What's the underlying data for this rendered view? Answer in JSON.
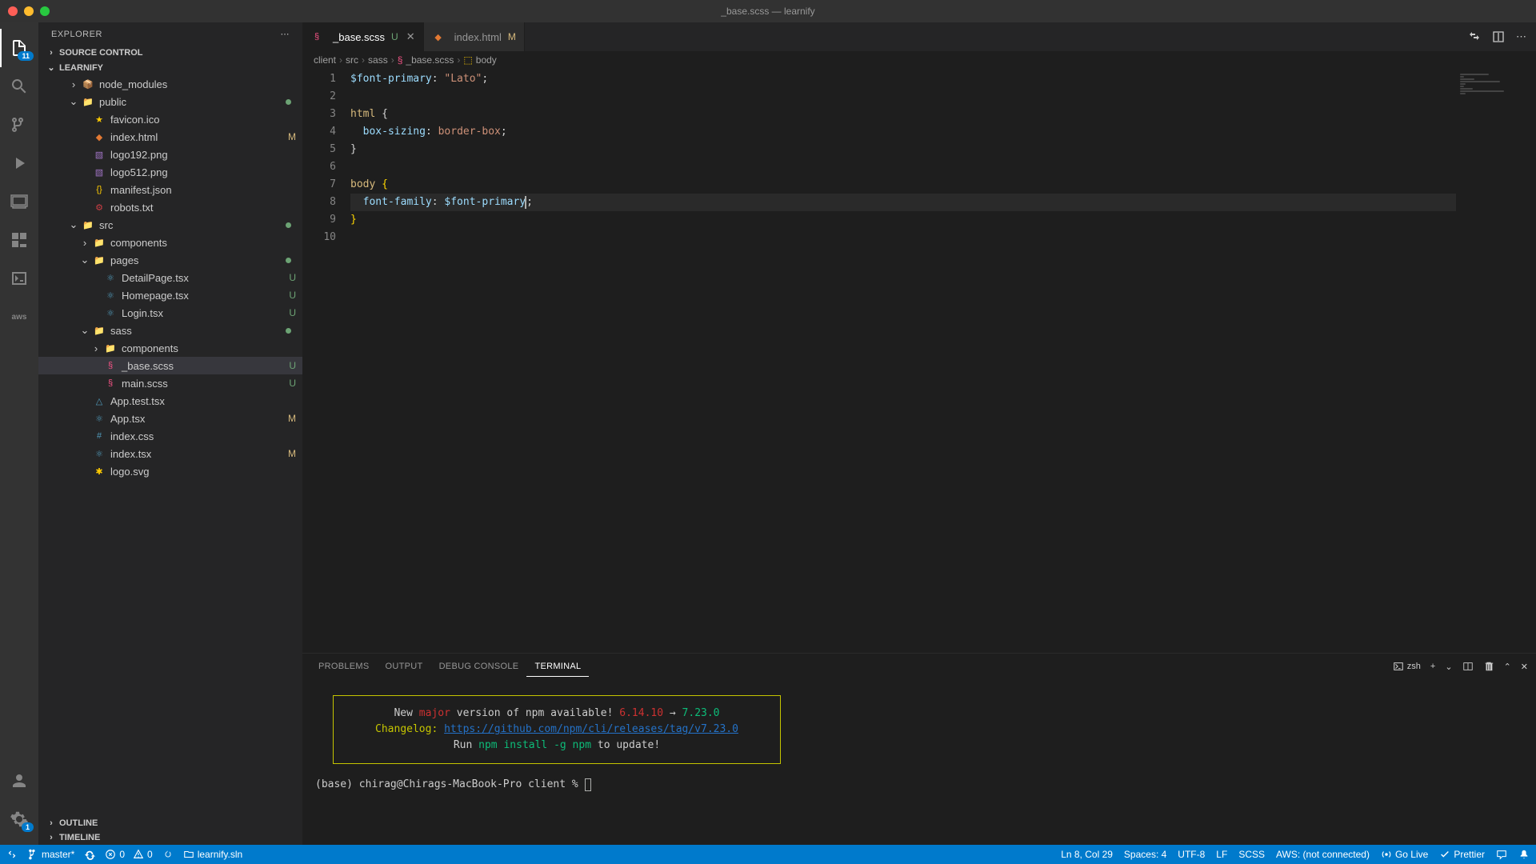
{
  "title": "_base.scss — learnify",
  "activity_badge": "11",
  "settings_badge": "1",
  "explorer": {
    "title": "EXPLORER",
    "sections": {
      "source_control": "SOURCE CONTROL",
      "project": "LEARNIFY",
      "outline": "OUTLINE",
      "timeline": "TIMELINE"
    },
    "tree": [
      {
        "label": "node_modules",
        "kind": "folder-closed",
        "indent": 2,
        "icon": "📦",
        "iconClass": "ic-green"
      },
      {
        "label": "public",
        "kind": "folder-open",
        "indent": 2,
        "icon": "📁",
        "iconClass": "ic-blue",
        "dot": true
      },
      {
        "label": "favicon.ico",
        "kind": "file",
        "indent": 3,
        "icon": "★",
        "iconClass": "ic-yellow"
      },
      {
        "label": "index.html",
        "kind": "file",
        "indent": 3,
        "icon": "◆",
        "iconClass": "ic-orange",
        "status": "M",
        "statusClass": "m"
      },
      {
        "label": "logo192.png",
        "kind": "file",
        "indent": 3,
        "icon": "▧",
        "iconClass": "ic-purple"
      },
      {
        "label": "logo512.png",
        "kind": "file",
        "indent": 3,
        "icon": "▧",
        "iconClass": "ic-purple"
      },
      {
        "label": "manifest.json",
        "kind": "file",
        "indent": 3,
        "icon": "{}",
        "iconClass": "ic-yellow"
      },
      {
        "label": "robots.txt",
        "kind": "file",
        "indent": 3,
        "icon": "⚙",
        "iconClass": "ic-red"
      },
      {
        "label": "src",
        "kind": "folder-open",
        "indent": 2,
        "icon": "📁",
        "iconClass": "ic-green",
        "dot": true
      },
      {
        "label": "components",
        "kind": "folder-closed",
        "indent": 3,
        "icon": "📁",
        "iconClass": "ic-yellow"
      },
      {
        "label": "pages",
        "kind": "folder-open",
        "indent": 3,
        "icon": "📁",
        "iconClass": "ic-orange",
        "dot": true
      },
      {
        "label": "DetailPage.tsx",
        "kind": "file",
        "indent": 4,
        "icon": "⚛",
        "iconClass": "ic-blue",
        "status": "U"
      },
      {
        "label": "Homepage.tsx",
        "kind": "file",
        "indent": 4,
        "icon": "⚛",
        "iconClass": "ic-blue",
        "status": "U"
      },
      {
        "label": "Login.tsx",
        "kind": "file",
        "indent": 4,
        "icon": "⚛",
        "iconClass": "ic-blue",
        "status": "U"
      },
      {
        "label": "sass",
        "kind": "folder-open",
        "indent": 3,
        "icon": "📁",
        "iconClass": "ic-pink",
        "dot": true
      },
      {
        "label": "components",
        "kind": "folder-closed",
        "indent": 4,
        "icon": "📁",
        "iconClass": "ic-yellow"
      },
      {
        "label": "_base.scss",
        "kind": "file",
        "indent": 4,
        "icon": "§",
        "iconClass": "ic-pink",
        "status": "U",
        "selected": true
      },
      {
        "label": "main.scss",
        "kind": "file",
        "indent": 4,
        "icon": "§",
        "iconClass": "ic-pink",
        "status": "U"
      },
      {
        "label": "App.test.tsx",
        "kind": "file",
        "indent": 3,
        "icon": "△",
        "iconClass": "ic-blue"
      },
      {
        "label": "App.tsx",
        "kind": "file",
        "indent": 3,
        "icon": "⚛",
        "iconClass": "ic-blue",
        "status": "M",
        "statusClass": "m"
      },
      {
        "label": "index.css",
        "kind": "file",
        "indent": 3,
        "icon": "#",
        "iconClass": "ic-blue"
      },
      {
        "label": "index.tsx",
        "kind": "file",
        "indent": 3,
        "icon": "⚛",
        "iconClass": "ic-blue",
        "status": "M",
        "statusClass": "m"
      },
      {
        "label": "logo.svg",
        "kind": "file",
        "indent": 3,
        "icon": "✱",
        "iconClass": "ic-yellow"
      }
    ]
  },
  "tabs": [
    {
      "label": "_base.scss",
      "mod": "U",
      "modClass": "u",
      "active": true,
      "close": true
    },
    {
      "label": "index.html",
      "mod": "M",
      "modClass": "m",
      "active": false
    }
  ],
  "breadcrumb": [
    "client",
    "src",
    "sass",
    "_base.scss",
    "body"
  ],
  "code": {
    "lines": [
      {
        "n": "1",
        "html": "<span class='tok-var'>$font-primary</span><span class='tok-punc'>: </span><span class='tok-str'>\"Lato\"</span><span class='tok-punc'>;</span>"
      },
      {
        "n": "2",
        "html": ""
      },
      {
        "n": "3",
        "html": "<span class='tok-sel'>html</span> <span class='tok-punc'>{</span>"
      },
      {
        "n": "4",
        "html": "  <span class='tok-prop'>box-sizing</span><span class='tok-punc'>: </span><span class='tok-val'>border-box</span><span class='tok-punc'>;</span>"
      },
      {
        "n": "5",
        "html": "<span class='tok-punc'>}</span>"
      },
      {
        "n": "6",
        "html": ""
      },
      {
        "n": "7",
        "html": "<span class='tok-sel'>body</span> <span class='tok-brace'>{</span>"
      },
      {
        "n": "8",
        "html": "  <span class='tok-prop'>font-family</span><span class='tok-punc'>: </span><span class='tok-var'>$font-primary</span><span class='cursor-mark'></span><span class='tok-punc'>;</span>",
        "current": true
      },
      {
        "n": "9",
        "html": "<span class='tok-brace'>}</span>"
      },
      {
        "n": "10",
        "html": ""
      }
    ]
  },
  "panel": {
    "tabs": {
      "problems": "PROBLEMS",
      "output": "OUTPUT",
      "debug": "DEBUG CONSOLE",
      "terminal": "TERMINAL"
    },
    "shell": "zsh",
    "npm": {
      "l1a": "New ",
      "l1b": "major",
      "l1c": " version of npm available! ",
      "l1d": "6.14.10",
      "l1e": " → ",
      "l1f": "7.23.0",
      "l2a": "Changelog: ",
      "l2b": "https://github.com/npm/cli/releases/tag/v7.23.0",
      "l3a": "Run ",
      "l3b": "npm install -g npm",
      "l3c": " to update!"
    },
    "prompt": "(base) chirag@Chirags-MacBook-Pro client % "
  },
  "statusbar": {
    "branch": "master*",
    "errors": "0",
    "warnings": "0",
    "sln": "learnify.sln",
    "cursor": "Ln 8, Col 29",
    "spaces": "Spaces: 4",
    "encoding": "UTF-8",
    "eol": "LF",
    "lang": "SCSS",
    "aws": "AWS: (not connected)",
    "golive": "Go Live",
    "prettier": "Prettier"
  }
}
